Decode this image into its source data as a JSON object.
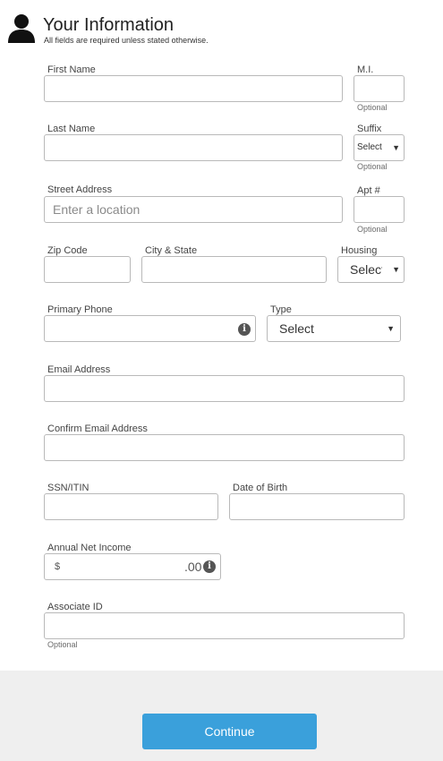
{
  "header": {
    "title": "Your Information",
    "subtitle": "All fields are required unless stated otherwise."
  },
  "optional_text": "Optional",
  "fields": {
    "first_name": {
      "label": "First Name",
      "value": ""
    },
    "mi": {
      "label": "M.I.",
      "value": ""
    },
    "last_name": {
      "label": "Last Name",
      "value": ""
    },
    "suffix": {
      "label": "Suffix",
      "selected": "Select"
    },
    "street_address": {
      "label": "Street Address",
      "value": "",
      "placeholder": "Enter a location"
    },
    "apt": {
      "label": "Apt #",
      "value": ""
    },
    "zip_code": {
      "label": "Zip Code",
      "value": ""
    },
    "city_state": {
      "label": "City & State",
      "value": ""
    },
    "housing": {
      "label": "Housing",
      "selected": "Select"
    },
    "primary_phone": {
      "label": "Primary Phone",
      "value": ""
    },
    "phone_type": {
      "label": "Type",
      "selected": "Select"
    },
    "email": {
      "label": "Email Address",
      "value": ""
    },
    "confirm_email": {
      "label": "Confirm Email Address",
      "value": ""
    },
    "ssn": {
      "label": "SSN/ITIN",
      "value": ""
    },
    "dob": {
      "label": "Date of Birth",
      "value": ""
    },
    "income": {
      "label": "Annual Net Income",
      "prefix": "$",
      "suffix": ".00",
      "value": ""
    },
    "associate_id": {
      "label": "Associate ID",
      "value": ""
    }
  },
  "actions": {
    "continue_label": "Continue"
  },
  "icons": {
    "user": "user-icon",
    "info": "info-icon"
  }
}
